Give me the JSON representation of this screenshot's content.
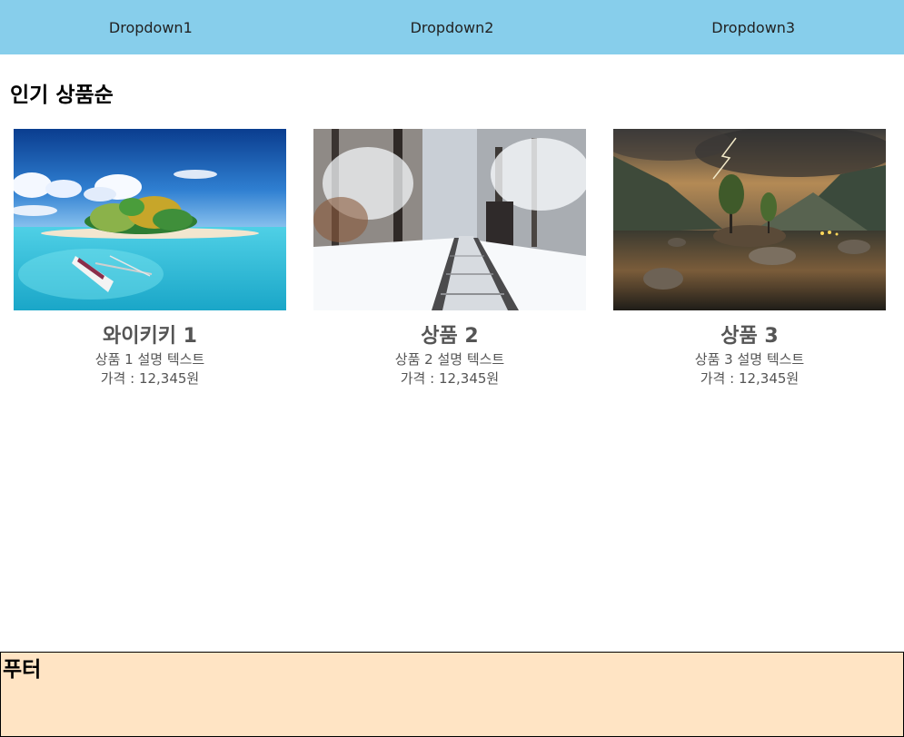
{
  "nav": {
    "items": [
      "Dropdown1",
      "Dropdown2",
      "Dropdown3"
    ]
  },
  "section": {
    "title": "인기 상품순"
  },
  "products": [
    {
      "title": "와이키키 1",
      "description": "상품 1 설명 텍스트",
      "price": "가격 : 12,345원",
      "image": "tropical-island-beach-image"
    },
    {
      "title": "상품 2",
      "description": "상품 2 설명 텍스트",
      "price": "가격 : 12,345원",
      "image": "snowy-railway-forest-image"
    },
    {
      "title": "상품 3",
      "description": "상품 3 설명 텍스트",
      "price": "가격 : 12,345원",
      "image": "stormy-lake-mountain-image"
    }
  ],
  "footer": {
    "title": "푸터"
  },
  "colors": {
    "nav_background": "#87ceeb",
    "footer_background": "#ffe4c4",
    "card_text": "#555555"
  }
}
